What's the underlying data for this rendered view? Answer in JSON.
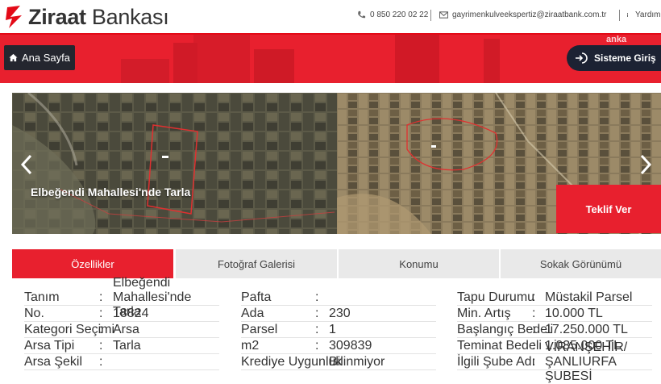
{
  "brand": {
    "name_bold": "Ziraat",
    "name_rest": " Bankası",
    "anka_text": "anka"
  },
  "header": {
    "phone": "0 850 220 02 22",
    "email": "gayrimenkulveekspertiz@ziraatbank.com.tr",
    "help": "Yardım"
  },
  "nav": {
    "home_label": "Ana Sayfa",
    "login_label": "Sisteme Giriş"
  },
  "slider": {
    "title": "Elbeğendi Mahallesi'nde Tarla",
    "offer_label": "Teklif Ver"
  },
  "tabs": [
    "Özellikler",
    "Fotoğraf Galerisi",
    "Konumu",
    "Sokak Görünümü"
  ],
  "colors": {
    "brand_red": "#e8202e",
    "dark_button": "#1c2233"
  },
  "properties": {
    "col1": [
      {
        "k": "Tanım",
        "v": "Elbeğendi Mahallesi'nde Tarla"
      },
      {
        "k": "No.",
        "v": "18824"
      },
      {
        "k": "Kategori Seçimi",
        "v": "Arsa"
      },
      {
        "k": "Arsa Tipi",
        "v": "Tarla"
      },
      {
        "k": "Arsa Şekil",
        "v": ""
      }
    ],
    "col2": [
      {
        "k": "Pafta",
        "v": ""
      },
      {
        "k": "Ada",
        "v": "230"
      },
      {
        "k": "Parsel",
        "v": "1"
      },
      {
        "k": "m2",
        "v": "309839"
      },
      {
        "k": "Krediye Uygunluk",
        "v": "Bilinmiyor"
      }
    ],
    "col3": [
      {
        "k": "Tapu Durumu",
        "v": "Müstakil Parsel"
      },
      {
        "k": "Min. Artış",
        "v": "10.000 TL"
      },
      {
        "k": "Başlangıç Bedeli",
        "v": "17.250.000 TL"
      },
      {
        "k": "Teminat Bedeli",
        "v": "1.035.000 TL"
      },
      {
        "k": "İlgili Şube Adı",
        "v": "VİRANŞEHİR/ŞANLIURFA ŞUBESİ"
      }
    ],
    "colon": ":"
  }
}
